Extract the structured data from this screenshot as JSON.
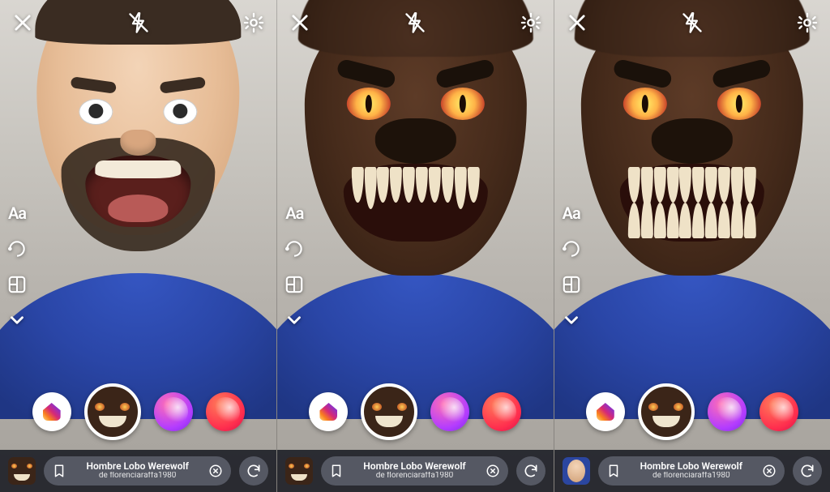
{
  "panels": [
    {
      "filter_thumb_variant": "wolf"
    },
    {
      "filter_thumb_variant": "wolf"
    },
    {
      "filter_thumb_variant": "human"
    }
  ],
  "topbar": {
    "close_label": "close",
    "flash_label": "flash off",
    "settings_label": "settings"
  },
  "toolstack": {
    "text_tool": "Aa",
    "boomerang_tool": "boomerang",
    "layout_tool": "layout",
    "more_tool": "more"
  },
  "carousel": {
    "home_label": "create",
    "selected_filter": "Hombre Lobo Werewolf",
    "alt1_label": "filter purple",
    "alt2_label": "filter red"
  },
  "filter_info": {
    "title": "Hombre Lobo Werewolf",
    "by_prefix": "de",
    "author": "florenciaraffa1980",
    "save_label": "save filter",
    "dismiss_label": "dismiss",
    "switch_camera_label": "switch camera"
  }
}
